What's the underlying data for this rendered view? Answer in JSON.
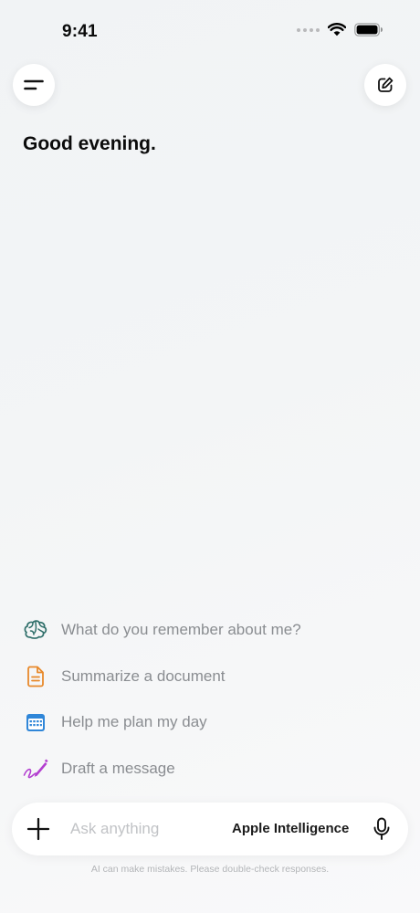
{
  "status_bar": {
    "time": "9:41",
    "icons": [
      "signal-dots-icon",
      "wifi-icon",
      "battery-icon"
    ]
  },
  "header": {
    "menu_icon": "menu-lines-icon",
    "compose_icon": "compose-icon"
  },
  "greeting": "Good evening.",
  "suggestions": [
    {
      "label": "What do you remember about me?",
      "icon": "brain-icon",
      "color": "#2f6f6a"
    },
    {
      "label": "Summarize a document",
      "icon": "document-icon",
      "color": "#e8892b"
    },
    {
      "label": "Help me plan my day",
      "icon": "calendar-icon",
      "color": "#2f86d8"
    },
    {
      "label": "Draft a message",
      "icon": "pen-icon",
      "color": "#b33fd0"
    }
  ],
  "input_bar": {
    "placeholder": "Ask anything",
    "model_label": "Apple Intelligence",
    "plus_icon": "plus-icon",
    "mic_icon": "microphone-icon"
  },
  "disclaimer": "AI can make mistakes. Please double-check responses."
}
